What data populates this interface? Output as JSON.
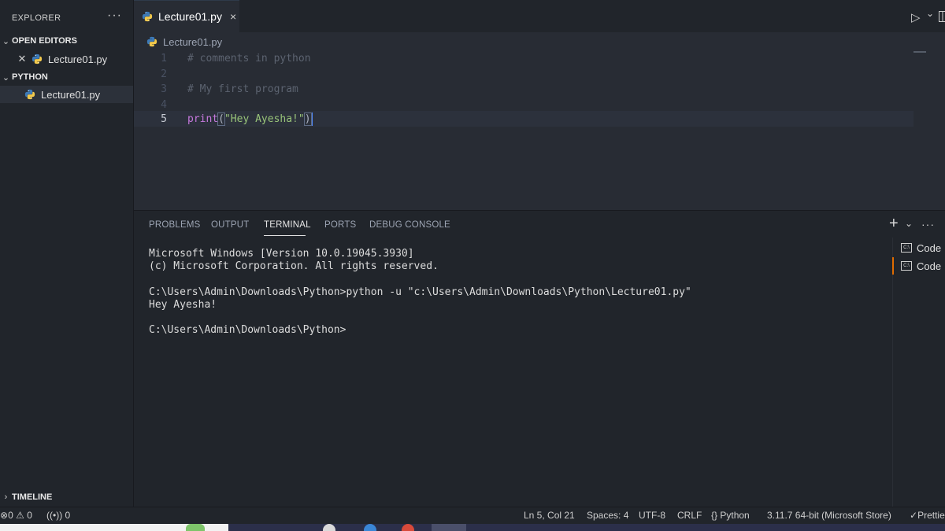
{
  "sidebar": {
    "title": "EXPLORER",
    "more": "···",
    "open_editors": {
      "label": "OPEN EDITORS",
      "file": "Lecture01.py"
    },
    "folder": {
      "label": "PYTHON",
      "file": "Lecture01.py"
    },
    "timeline": "TIMELINE"
  },
  "tab": {
    "label": "Lecture01.py",
    "close": "×"
  },
  "toolbar": {
    "run": "▷",
    "chevron": "⌄"
  },
  "breadcrumb": {
    "file": "Lecture01.py"
  },
  "editor": {
    "line_numbers": [
      "1",
      "2",
      "3",
      "4",
      "5"
    ],
    "line1": "# comments in python",
    "line3": "# My first program",
    "line5_fn": "print",
    "line5_open": "(",
    "line5_str": "\"Hey Ayesha!\"",
    "line5_close": ")"
  },
  "panel": {
    "tabs": [
      "PROBLEMS",
      "OUTPUT",
      "TERMINAL",
      "PORTS",
      "DEBUG CONSOLE"
    ],
    "active_tab": "TERMINAL",
    "add": "+",
    "more": "···",
    "terminal_output": "Microsoft Windows [Version 10.0.19045.3930]\n(c) Microsoft Corporation. All rights reserved.\n\nC:\\Users\\Admin\\Downloads\\Python>python -u \"c:\\Users\\Admin\\Downloads\\Python\\Lecture01.py\"\nHey Ayesha!\n\nC:\\Users\\Admin\\Downloads\\Python>",
    "terminals": [
      "Code",
      "Code"
    ]
  },
  "statusbar": {
    "errors": "0",
    "warnings": "0",
    "ports": "0",
    "position": "Ln 5, Col 21",
    "spaces": "Spaces: 4",
    "encoding": "UTF-8",
    "eol": "CRLF",
    "language": "Python",
    "interpreter": "3.11.7 64-bit (Microsoft Store)",
    "prettier": "Prettie"
  },
  "colors": {
    "accent": "#528bff",
    "comment": "#5c6370",
    "function": "#c678dd",
    "string": "#98c379"
  }
}
